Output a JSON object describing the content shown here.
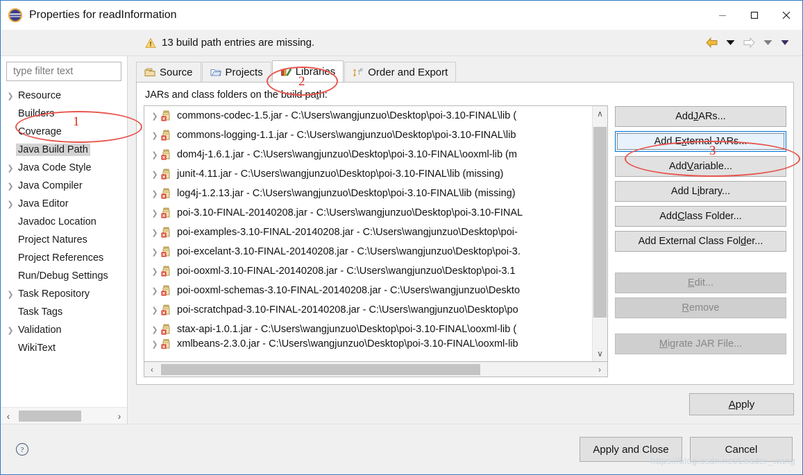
{
  "window": {
    "title": "Properties for readInformation",
    "icon": "eclipse-globe-icon",
    "minimize_label": "—",
    "maximize_label": "□",
    "close_label": "✕"
  },
  "warning": {
    "icon": "warning-triangle-icon",
    "text": "13 build path entries are missing."
  },
  "navigation": {
    "back": "back-arrow",
    "back_menu": "▼",
    "forward": "forward-arrow",
    "forward_menu": "▼",
    "view_menu": "▼"
  },
  "sidebar": {
    "filter_placeholder": "type filter text",
    "filter_value": "",
    "items": [
      {
        "label": "Resource",
        "expandable": true,
        "selected": false
      },
      {
        "label": "Builders",
        "expandable": false,
        "selected": false
      },
      {
        "label": "Coverage",
        "expandable": false,
        "selected": false
      },
      {
        "label": "Java Build Path",
        "expandable": false,
        "selected": true
      },
      {
        "label": "Java Code Style",
        "expandable": true,
        "selected": false
      },
      {
        "label": "Java Compiler",
        "expandable": true,
        "selected": false
      },
      {
        "label": "Java Editor",
        "expandable": true,
        "selected": false
      },
      {
        "label": "Javadoc Location",
        "expandable": false,
        "selected": false
      },
      {
        "label": "Project Natures",
        "expandable": false,
        "selected": false
      },
      {
        "label": "Project References",
        "expandable": false,
        "selected": false
      },
      {
        "label": "Run/Debug Settings",
        "expandable": false,
        "selected": false
      },
      {
        "label": "Task Repository",
        "expandable": true,
        "selected": false
      },
      {
        "label": "Task Tags",
        "expandable": false,
        "selected": false
      },
      {
        "label": "Validation",
        "expandable": true,
        "selected": false
      },
      {
        "label": "WikiText",
        "expandable": false,
        "selected": false
      }
    ],
    "scroll_left": "‹",
    "scroll_right": "›"
  },
  "tabs": [
    {
      "label": "Source",
      "icon": "source-folder-icon",
      "active": false
    },
    {
      "label": "Projects",
      "icon": "project-folder-icon",
      "active": false
    },
    {
      "label": "Libraries",
      "icon": "libraries-books-icon",
      "active": true
    },
    {
      "label": "Order and Export",
      "icon": "order-export-icon",
      "active": false
    }
  ],
  "main": {
    "list_label": "JARs and class folders on the build path:",
    "list_label_mnemonic": "t",
    "jars": [
      "commons-codec-1.5.jar - C:\\Users\\wangjunzuo\\Desktop\\poi-3.10-FINAL\\lib (",
      "commons-logging-1.1.jar - C:\\Users\\wangjunzuo\\Desktop\\poi-3.10-FINAL\\lib",
      "dom4j-1.6.1.jar - C:\\Users\\wangjunzuo\\Desktop\\poi-3.10-FINAL\\ooxml-lib (m",
      "junit-4.11.jar - C:\\Users\\wangjunzuo\\Desktop\\poi-3.10-FINAL\\lib (missing)",
      "log4j-1.2.13.jar - C:\\Users\\wangjunzuo\\Desktop\\poi-3.10-FINAL\\lib (missing)",
      "poi-3.10-FINAL-20140208.jar - C:\\Users\\wangjunzuo\\Desktop\\poi-3.10-FINAL",
      "poi-examples-3.10-FINAL-20140208.jar - C:\\Users\\wangjunzuo\\Desktop\\poi-",
      "poi-excelant-3.10-FINAL-20140208.jar - C:\\Users\\wangjunzuo\\Desktop\\poi-3.",
      "poi-ooxml-3.10-FINAL-20140208.jar - C:\\Users\\wangjunzuo\\Desktop\\poi-3.1",
      "poi-ooxml-schemas-3.10-FINAL-20140208.jar - C:\\Users\\wangjunzuo\\Deskto",
      "poi-scratchpad-3.10-FINAL-20140208.jar - C:\\Users\\wangjunzuo\\Desktop\\po",
      "stax-api-1.0.1.jar - C:\\Users\\wangjunzuo\\Desktop\\poi-3.10-FINAL\\ooxml-lib (",
      "xmlbeans-2.3.0.jar - C:\\Users\\wangjunzuo\\Desktop\\poi-3.10-FINAL\\ooxml-lib"
    ],
    "scroll_up": "∧",
    "scroll_down": "∨",
    "scroll_left": "‹",
    "scroll_right": "›"
  },
  "buttons": {
    "add_jars": "Add JARs...",
    "add_external_jars": "Add External JARs...",
    "add_variable": "Add Variable...",
    "add_library": "Add Library...",
    "add_class_folder": "Add Class Folder...",
    "add_external_class_folder": "Add External Class Folder...",
    "edit": "Edit...",
    "remove": "Remove",
    "migrate_jar_file": "Migrate JAR File...",
    "apply": "Apply"
  },
  "footer": {
    "help_icon": "help-question-icon",
    "apply_and_close": "Apply and Close",
    "cancel": "Cancel",
    "watermark": "https://blog.csdn.net/Leader_wang"
  },
  "annotations": [
    {
      "number": "1",
      "target": "Java Build Path"
    },
    {
      "number": "2",
      "target": "Libraries"
    },
    {
      "number": "3",
      "target": "Add External JARs..."
    }
  ],
  "colors": {
    "accent": "#0078d7",
    "annotation_red": "#e8554e",
    "warning_amber": "#e8a33d",
    "focus_fill": "#e8f2fc"
  }
}
